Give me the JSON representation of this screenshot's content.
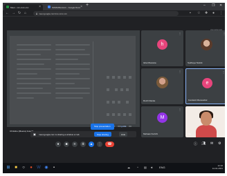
{
  "browser": {
    "tabs": [
      {
        "label": "Meet - xxx-xxxx-xxx",
        "fav_color": "#1e8e3e",
        "active": true
      },
      {
        "label": "SOMAISH.docx - Google Docs",
        "fav_color": "#4285f4",
        "active": false
      }
    ],
    "new_tab": "+",
    "url": "meet.google.com/xxx-xxxx-xxx",
    "window_buttons": [
      "–",
      "❐",
      "✕"
    ]
  },
  "meeting": {
    "code_label": "xxx-xxxx-xxx",
    "presenter_label": "Christine (Meena) Joseph",
    "participants": [
      {
        "name": "Isha Dhanuka",
        "initial": "h",
        "color": "#e8457c",
        "type": "avatar"
      },
      {
        "name": "Sudheya Tantrik",
        "initial": "",
        "color": "",
        "type": "photo"
      },
      {
        "name": "Ruchi Ranka",
        "initial": "",
        "color": "",
        "type": "photo"
      },
      {
        "name": "Kundanti Manoashel",
        "initial": "e",
        "color": "#e8457c",
        "type": "avatar"
      },
      {
        "name": "Mehaan Kurtchi",
        "initial": "M",
        "color": "#9334e6",
        "type": "avatar"
      },
      {
        "name": "You",
        "initial": "",
        "color": "",
        "type": "camera"
      }
    ]
  },
  "notifications": {
    "toast_text": "Stop presentation",
    "toast_dismiss": "Ignore",
    "share_message": "meet.google.com is sharing a window or tab",
    "stop_sharing": "Stop sharing",
    "hide": "Hide"
  },
  "controls": {
    "mic_icon": "mic-icon",
    "cam_icon": "camera-icon",
    "cc_icon": "captions-icon",
    "hand_icon": "hand-icon",
    "present_icon": "present-icon",
    "more_icon": "more-icon",
    "end_icon": "end-call-icon"
  },
  "taskbar": {
    "language": "ENG",
    "clock_time": "12:16",
    "clock_date": "14-01-2021"
  }
}
